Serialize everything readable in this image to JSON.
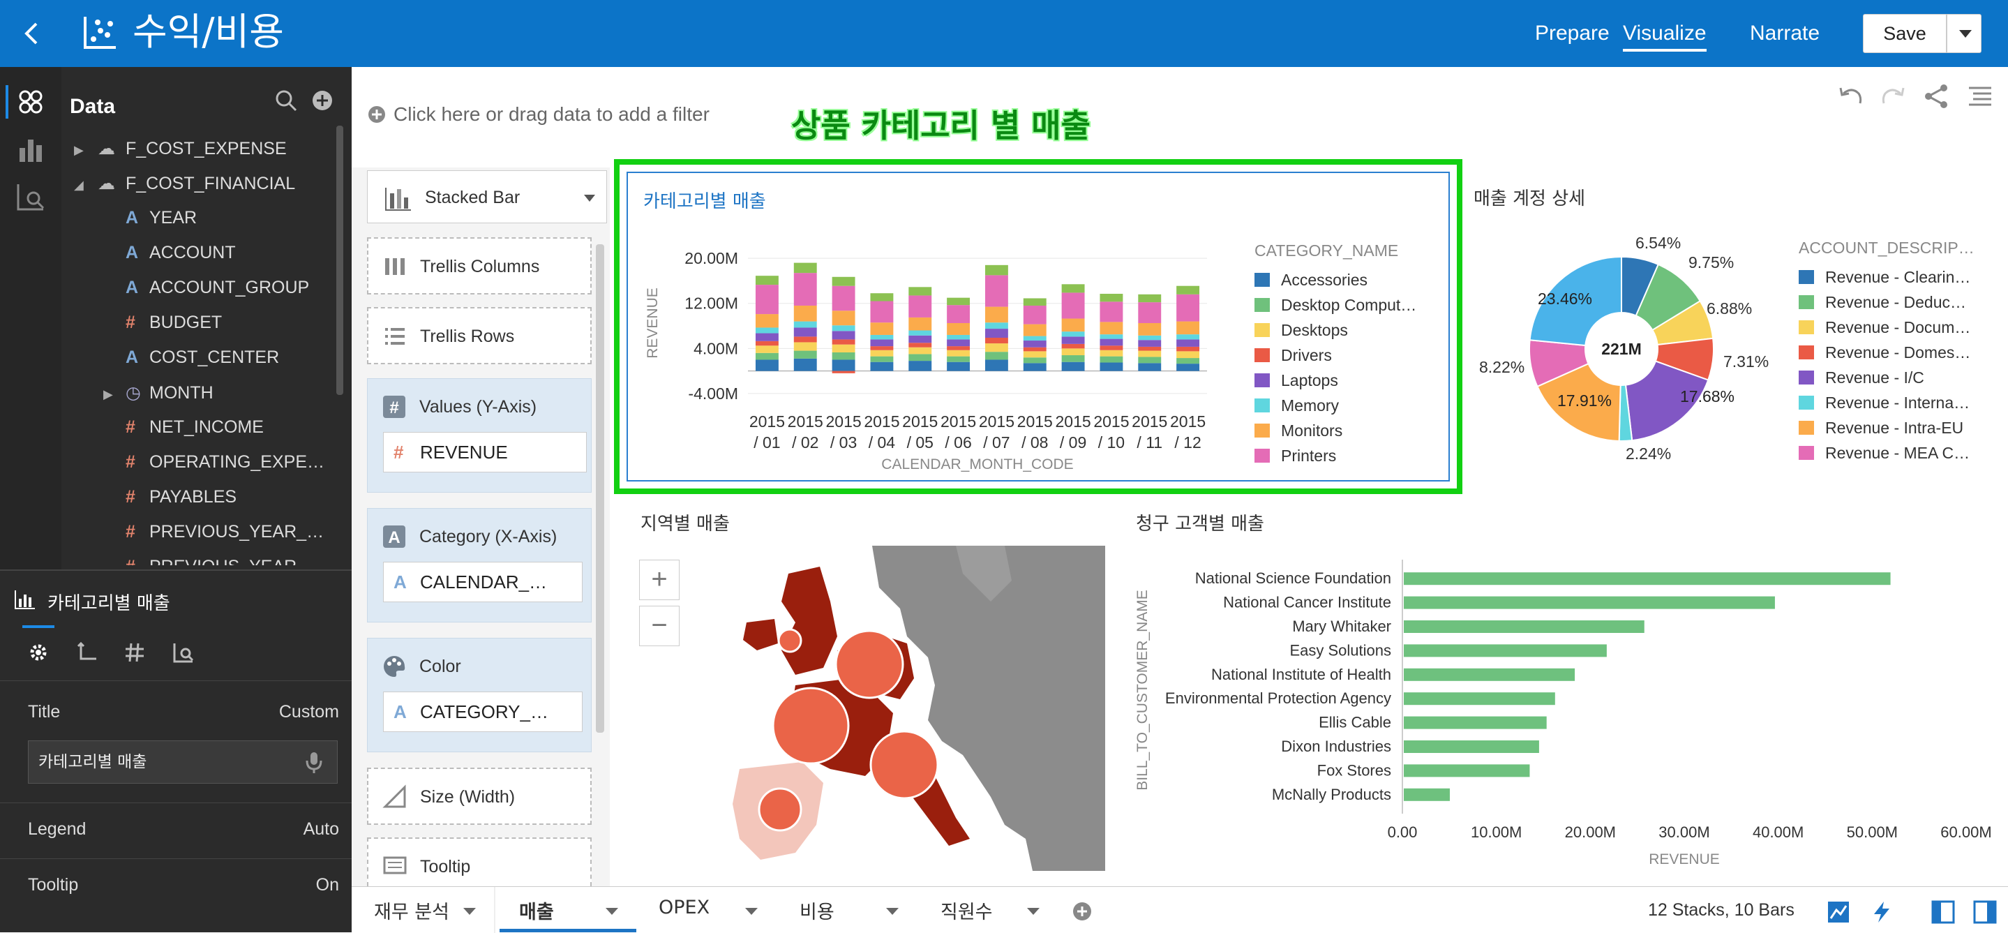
{
  "app": {
    "title": "수익/비용"
  },
  "nav": {
    "prepare": "Prepare",
    "visualize": "Visualize",
    "narrate": "Narrate",
    "save": "Save"
  },
  "data_panel": {
    "title": "Data",
    "tree": [
      {
        "label": "F_COST_EXPENSE",
        "type": "source"
      },
      {
        "label": "F_COST_FINANCIAL",
        "type": "source"
      },
      {
        "label": "YEAR",
        "type": "attribute"
      },
      {
        "label": "ACCOUNT",
        "type": "attribute"
      },
      {
        "label": "ACCOUNT_GROUP",
        "type": "attribute"
      },
      {
        "label": "BUDGET",
        "type": "measure"
      },
      {
        "label": "COST_CENTER",
        "type": "attribute"
      },
      {
        "label": "MONTH",
        "type": "time"
      },
      {
        "label": "NET_INCOME",
        "type": "measure"
      },
      {
        "label": "OPERATING_EXPE…",
        "type": "measure"
      },
      {
        "label": "PAYABLES",
        "type": "measure"
      },
      {
        "label": "PREVIOUS_YEAR_…",
        "type": "measure"
      },
      {
        "label": "PREVIOUS_YEAR",
        "type": "measure"
      }
    ]
  },
  "properties": {
    "viz_name": "카테고리별 매출",
    "rows": [
      {
        "key": "Title",
        "value": "Custom"
      },
      {
        "key": "Legend",
        "value": "Auto"
      },
      {
        "key": "Tooltip",
        "value": "On"
      }
    ],
    "title_value": "카테고리별 매출"
  },
  "filter": {
    "placeholder": "Click here or drag data to add a filter"
  },
  "annotation": "상품 카테고리 별 매출",
  "grammar": {
    "chart_type": "Stacked Bar",
    "trellis_columns": "Trellis Columns",
    "trellis_rows": "Trellis Rows",
    "values_label": "Values (Y-Axis)",
    "values_item": "REVENUE",
    "category_label": "Category (X-Axis)",
    "category_item": "CALENDAR_…",
    "color_label": "Color",
    "color_item": "CATEGORY_…",
    "size_label": "Size (Width)",
    "tooltip_label": "Tooltip"
  },
  "viz_titles": {
    "category": "카테고리별 매출",
    "account": "매출 계정 상세",
    "region": "지역별 매출",
    "customer": "청구 고객별 매출"
  },
  "legends": {
    "category_title": "CATEGORY_NAME",
    "category_items": [
      "Accessories",
      "Desktop Comput…",
      "Desktops",
      "Drivers",
      "Laptops",
      "Memory",
      "Monitors",
      "Printers"
    ],
    "account_title": "ACCOUNT_DESCRIP…",
    "account_items": [
      "Revenue - Clearin…",
      "Revenue - Deduc…",
      "Revenue - Docum…",
      "Revenue - Domes…",
      "Revenue - I/C",
      "Revenue - Interna…",
      "Revenue - Intra-EU",
      "Revenue - MEA C…"
    ]
  },
  "colors": {
    "series": [
      "#2e76b5",
      "#6fc17c",
      "#f8d35a",
      "#ea5a45",
      "#8157c4",
      "#5fd6df",
      "#fbab4b",
      "#e46cb6",
      "#8cc152"
    ],
    "hbar": "#6ec17e",
    "accent": "#0c74c8",
    "highlight": "#12d012"
  },
  "chart_data": [
    {
      "type": "bar",
      "stacked": true,
      "title": "카테고리별 매출",
      "xlabel": "CALENDAR_MONTH_CODE",
      "ylabel": "REVENUE",
      "ylim": [
        -5,
        22
      ],
      "yticks": [
        "20.00M",
        "12.00M",
        "4.00M",
        "-4.00M"
      ],
      "categories": [
        "2015 / 01",
        "2015 / 02",
        "2015 / 03",
        "2015 / 04",
        "2015 / 05",
        "2015 / 06",
        "2015 / 07",
        "2015 / 08",
        "2015 / 09",
        "2015 / 10",
        "2015 / 11",
        "2015 / 12"
      ],
      "series": [
        {
          "name": "Accessories",
          "values": [
            2.0,
            2.2,
            2.0,
            1.6,
            1.8,
            1.6,
            2.0,
            1.4,
            1.6,
            1.5,
            1.4,
            1.3
          ]
        },
        {
          "name": "Desktop Comput…",
          "values": [
            1.2,
            1.4,
            1.3,
            1.0,
            1.2,
            1.0,
            1.4,
            1.0,
            1.2,
            1.1,
            1.1,
            1.0
          ]
        },
        {
          "name": "Desktops",
          "values": [
            1.3,
            1.5,
            1.4,
            1.1,
            1.2,
            1.1,
            1.5,
            1.1,
            1.2,
            1.1,
            1.1,
            1.2
          ]
        },
        {
          "name": "Drivers",
          "values": [
            0.8,
            1.0,
            0.9,
            0.7,
            0.8,
            0.7,
            1.0,
            0.7,
            0.8,
            0.8,
            0.7,
            0.8
          ]
        },
        {
          "name": "Laptops",
          "values": [
            1.4,
            1.6,
            1.5,
            1.2,
            1.3,
            1.2,
            1.6,
            1.2,
            1.3,
            1.2,
            1.2,
            1.3
          ]
        },
        {
          "name": "Memory",
          "values": [
            1.0,
            1.1,
            1.0,
            0.8,
            0.9,
            0.8,
            1.1,
            0.8,
            0.9,
            0.8,
            0.8,
            0.9
          ]
        },
        {
          "name": "Monitors",
          "values": [
            2.4,
            2.8,
            2.6,
            2.2,
            2.3,
            2.1,
            2.8,
            2.1,
            2.3,
            2.2,
            2.2,
            2.3
          ]
        },
        {
          "name": "Printers",
          "values": [
            5.2,
            5.8,
            4.4,
            3.8,
            3.9,
            3.2,
            5.6,
            3.3,
            4.6,
            3.6,
            3.7,
            4.8
          ]
        },
        {
          "name": "",
          "values": [
            1.6,
            1.8,
            1.6,
            1.4,
            1.5,
            1.3,
            1.8,
            1.3,
            1.5,
            1.4,
            1.4,
            1.5
          ]
        }
      ]
    },
    {
      "type": "pie",
      "title": "매출 계정 상세",
      "center_label": "221M",
      "series": [
        {
          "name": "Revenue - Clearin…",
          "value": 6.54
        },
        {
          "name": "Revenue - Deduc…",
          "value": 9.75
        },
        {
          "name": "Revenue - Docum…",
          "value": 6.88
        },
        {
          "name": "Revenue - Domes…",
          "value": 7.31
        },
        {
          "name": "Revenue - I/C",
          "value": 17.68
        },
        {
          "name": "Revenue - Interna…",
          "value": 2.24
        },
        {
          "name": "Revenue - Intra-EU",
          "value": 17.91
        },
        {
          "name": "Revenue - MEA C…",
          "value": 8.22
        },
        {
          "name": "",
          "value": 23.46
        }
      ],
      "labels": [
        "6.54%",
        "9.75%",
        "6.88%",
        "7.31%",
        "17.68%",
        "2.24%",
        "17.91%",
        "8.22%",
        "23.46%"
      ]
    },
    {
      "type": "bar",
      "orientation": "horizontal",
      "title": "청구 고객별 매출",
      "xlabel": "REVENUE",
      "ylabel": "BILL_TO_CUSTOMER_NAME",
      "xlim": [
        0,
        60
      ],
      "xticks": [
        "0.00",
        "10.00M",
        "20.00M",
        "30.00M",
        "40.00M",
        "50.00M",
        "60.00M"
      ],
      "categories": [
        "National Science Foundation",
        "National Cancer Institute",
        "Mary Whitaker",
        "Easy Solutions",
        "National Institute of Health",
        "Environmental Protection Agency",
        "Ellis Cable",
        "Dixon Industries",
        "Fox Stores",
        "McNally Products"
      ],
      "values": [
        51.8,
        39.5,
        25.6,
        21.6,
        18.2,
        16.1,
        15.2,
        14.4,
        13.4,
        4.9
      ]
    }
  ],
  "map": {
    "title": "지역별 매출",
    "zoom_in": "+",
    "zoom_out": "−"
  },
  "tabs": [
    "재무 분석",
    "매출",
    "OPEX",
    "비용",
    "직원수"
  ],
  "status": {
    "text": "12 Stacks, 10 Bars"
  }
}
